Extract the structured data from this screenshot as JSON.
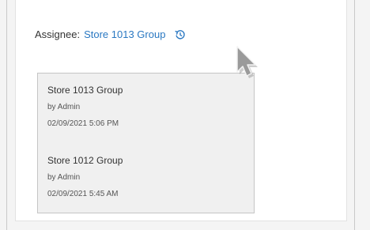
{
  "assignee": {
    "label": "Assignee:",
    "value": "Store 1013 Group",
    "history_icon": "history-clock-icon"
  },
  "history": {
    "entries": [
      {
        "group": "Store 1013 Group",
        "by": "by Admin",
        "date": "02/09/2021 5:06 PM"
      },
      {
        "group": "Store 1012 Group",
        "by": "by Admin",
        "date": "02/09/2021 5:45 AM"
      }
    ]
  },
  "colors": {
    "link": "#2a78c2",
    "panel_bg": "#f0f0f0",
    "panel_border": "#c5c5c5"
  },
  "cursor_icon": "mouse-pointer-icon"
}
